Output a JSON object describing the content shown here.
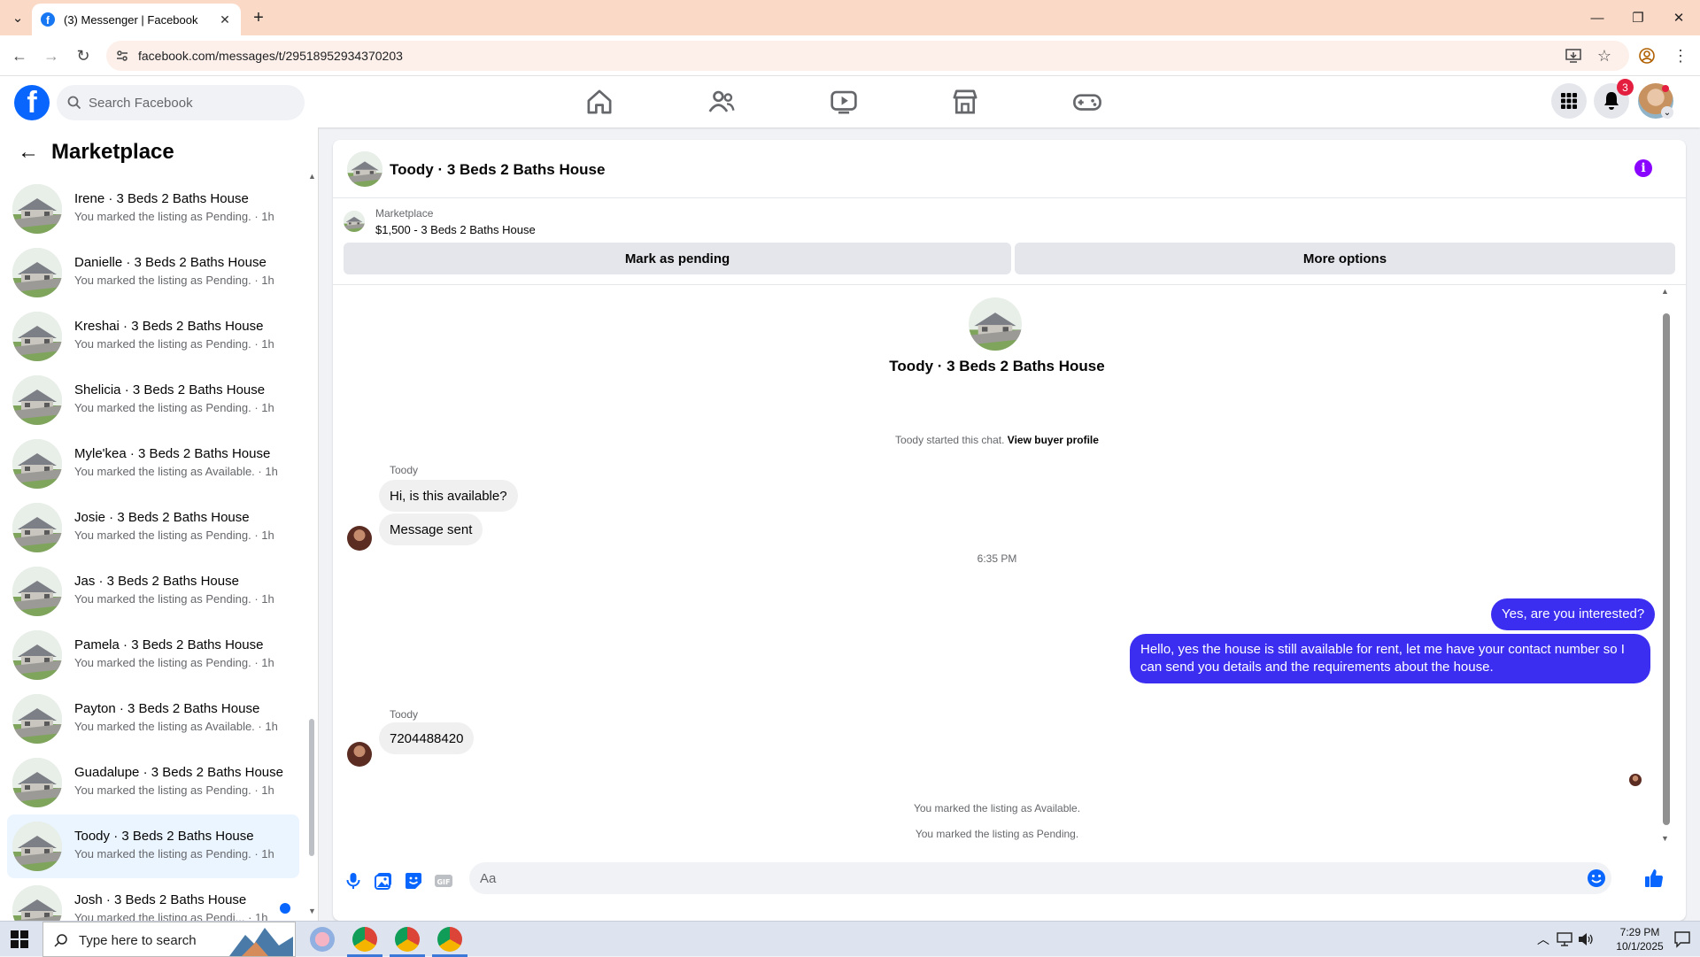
{
  "browser": {
    "tab_title": "(3) Messenger | Facebook",
    "url": "facebook.com/messages/t/29518952934370203"
  },
  "fb": {
    "search_placeholder": "Search Facebook",
    "notification_count": "3"
  },
  "sidebar": {
    "title": "Marketplace",
    "conversations": [
      {
        "name": "Irene · 3 Beds 2 Baths House",
        "status": "You marked the listing as Pending. · 1h"
      },
      {
        "name": "Danielle · 3 Beds 2 Baths House",
        "status": "You marked the listing as Pending. · 1h"
      },
      {
        "name": "Kreshai · 3 Beds 2 Baths House",
        "status": "You marked the listing as Pending. · 1h"
      },
      {
        "name": "Shelicia · 3 Beds 2 Baths House",
        "status": "You marked the listing as Pending. · 1h"
      },
      {
        "name": "Myle'kea · 3 Beds 2 Baths House",
        "status": "You marked the listing as Available. · 1h"
      },
      {
        "name": "Josie · 3 Beds 2 Baths House",
        "status": "You marked the listing as Pending. · 1h"
      },
      {
        "name": "Jas · 3 Beds 2 Baths House",
        "status": "You marked the listing as Pending. · 1h"
      },
      {
        "name": "Pamela · 3 Beds 2 Baths House",
        "status": "You marked the listing as Pending. · 1h"
      },
      {
        "name": "Payton · 3 Beds 2 Baths House",
        "status": "You marked the listing as Available. · 1h"
      },
      {
        "name": "Guadalupe · 3 Beds 2 Baths House",
        "status": "You marked the listing as Pending. · 1h"
      },
      {
        "name": "Toody · 3 Beds 2 Baths House",
        "status": "You marked the listing as Pending. · 1h"
      },
      {
        "name": "Josh · 3 Beds 2 Baths House",
        "status": "You marked the listing as Pendi... · 1h"
      }
    ]
  },
  "chat": {
    "title": "Toody · 3 Beds 2 Baths House",
    "listing_label": "Marketplace",
    "listing_price": "$1,500 - 3 Beds 2 Baths House",
    "mark_pending_label": "Mark as pending",
    "more_options_label": "More options",
    "intro_name": "Toody · 3 Beds 2 Baths House",
    "started_text": "Toody started this chat.",
    "view_profile_label": "View buyer profile",
    "sender_name_1": "Toody",
    "msg_in_1": "Hi, is this available?",
    "msg_in_2": "Message sent",
    "timestamp": "6:35 PM",
    "msg_out_1": "Yes, are you interested?",
    "msg_out_2": "Hello, yes the house is still available for rent, let me have your contact number so I can send you details and the requirements about the house.",
    "sender_name_2": "Toody",
    "msg_in_3": "7204488420",
    "status_available": "You marked the listing as Available.",
    "status_pending": "You marked the listing as Pending.",
    "input_placeholder": "Aa"
  },
  "taskbar": {
    "search_placeholder": "Type here to search",
    "time": "7:29 PM",
    "date": "10/1/2025"
  },
  "colors": {
    "fb_blue": "#0866ff",
    "outgoing_bubble": "#3b2ef0",
    "active_conv_bg": "#ebf5ff"
  }
}
